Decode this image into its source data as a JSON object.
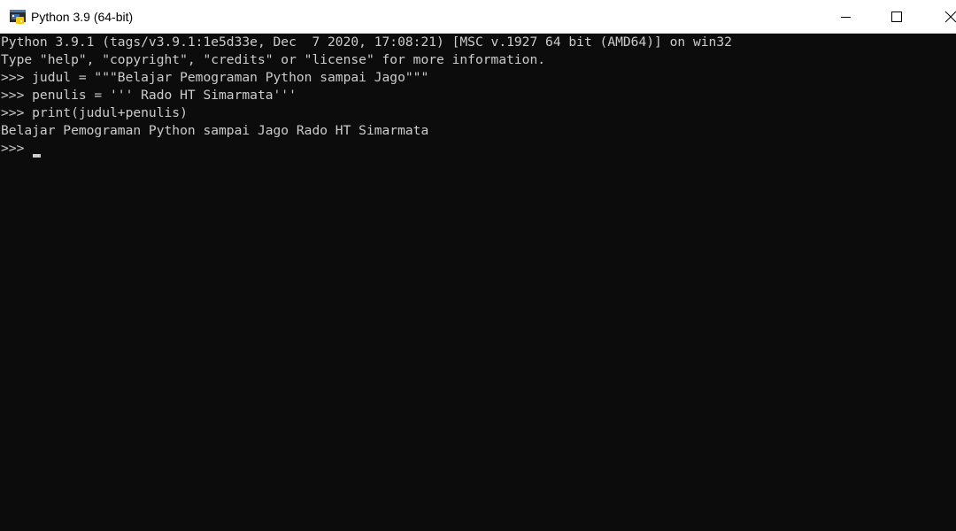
{
  "window": {
    "title": "Python 3.9 (64-bit)",
    "icon": "python-icon",
    "controls": {
      "minimize_icon": "minimize-icon",
      "maximize_icon": "maximize-icon",
      "close_icon": "close-icon"
    }
  },
  "console": {
    "lines": [
      "Python 3.9.1 (tags/v3.9.1:1e5d33e, Dec  7 2020, 17:08:21) [MSC v.1927 64 bit (AMD64)] on win32",
      "Type \"help\", \"copyright\", \"credits\" or \"license\" for more information.",
      ">>> judul = \"\"\"Belajar Pemograman Python sampai Jago\"\"\"",
      ">>> penulis = ''' Rado HT Simarmata'''",
      ">>> print(judul+penulis)",
      "Belajar Pemograman Python sampai Jago Rado HT Simarmata",
      ">>> "
    ],
    "colors": {
      "background": "#0c0c0c",
      "foreground": "#cccccc"
    }
  }
}
